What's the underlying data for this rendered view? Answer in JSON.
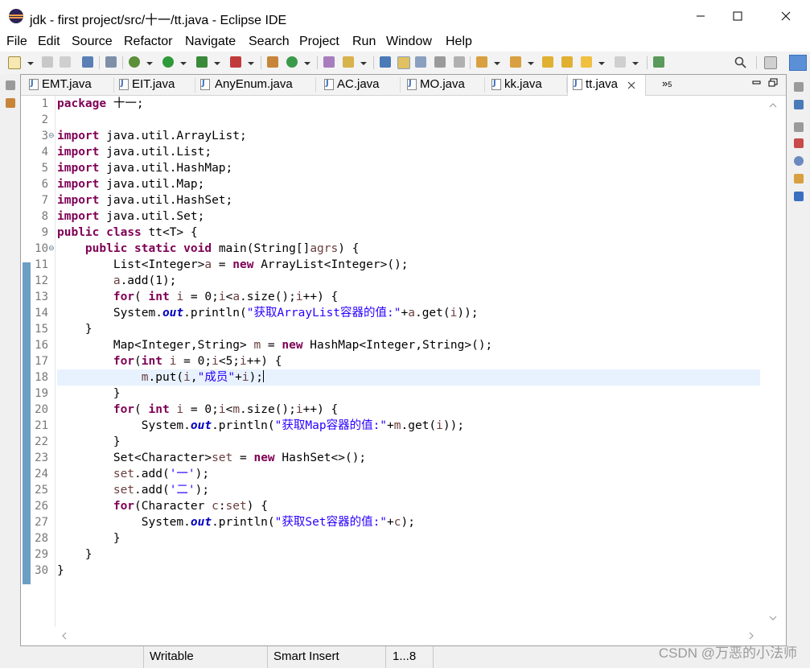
{
  "window": {
    "title": "jdk - first project/src/十一/tt.java - Eclipse IDE"
  },
  "menu": [
    "File",
    "Edit",
    "Source",
    "Refactor",
    "Navigate",
    "Search",
    "Project",
    "Run",
    "Window",
    "Help"
  ],
  "tabs": [
    "EMT.java",
    "EIT.java",
    "AnyEnum.java",
    "AC.java",
    "MO.java",
    "kk.java",
    "tt.java"
  ],
  "active_tab": "tt.java",
  "tabs_overflow_count": "5",
  "editor": {
    "line_numbers": [
      "1",
      "2",
      "3",
      "4",
      "5",
      "6",
      "7",
      "8",
      "9",
      "10",
      "11",
      "12",
      "13",
      "14",
      "15",
      "16",
      "17",
      "18",
      "19",
      "20",
      "21",
      "22",
      "23",
      "24",
      "25",
      "26",
      "27",
      "28",
      "29",
      "30"
    ],
    "lines": {
      "l1": {
        "a": "package",
        "b": " 十一;"
      },
      "l3": {
        "a": "import",
        "b": " java.util.ArrayList;"
      },
      "l4": {
        "a": "import",
        "b": " java.util.List;"
      },
      "l5": {
        "a": "import",
        "b": " java.util.HashMap;"
      },
      "l6": {
        "a": "import",
        "b": " java.util.Map;"
      },
      "l7": {
        "a": "import",
        "b": " java.util.HashSet;"
      },
      "l8": {
        "a": "import",
        "b": " java.util.Set;"
      },
      "l9": {
        "a": "public",
        "b": " ",
        "c": "class",
        "d": " tt<T> {"
      },
      "l10": {
        "pre": "    ",
        "a": "public",
        "b": " ",
        "c": "static",
        "d": " ",
        "e": "void",
        "f": " main(String[]",
        "g": "agrs",
        "h": ") {"
      },
      "l11": {
        "pre": "        List<Integer>",
        "a": "a",
        "b": " = ",
        "c": "new",
        "d": " ArrayList<Integer>();"
      },
      "l12": {
        "pre": "        ",
        "a": "a",
        "b": ".add(1);"
      },
      "l13": {
        "pre": "        ",
        "a": "for",
        "b": "( ",
        "c": "int",
        "d": " ",
        "e": "i",
        "f": " = 0;",
        "g": "i",
        "h": "<",
        "i": "a",
        "j": ".size();",
        "k": "i",
        "l": "++) {"
      },
      "l14": {
        "pre": "        System.",
        "a": "out",
        "b": ".println(",
        "c": "\"获取ArrayList容器的值:\"",
        "d": "+",
        "e": "a",
        "f": ".get(",
        "g": "i",
        "h": "));"
      },
      "l15": {
        "pre": "    }"
      },
      "l16": {
        "pre": "        Map<Integer,String> ",
        "a": "m",
        "b": " = ",
        "c": "new",
        "d": " HashMap<Integer,String>();"
      },
      "l17": {
        "pre": "        ",
        "a": "for",
        "b": "(",
        "c": "int",
        "d": " ",
        "e": "i",
        "f": " = 0;",
        "g": "i",
        "h": "<5;",
        "i": "i",
        "j": "++) {"
      },
      "l18": {
        "pre": "            ",
        "a": "m",
        "b": ".put(",
        "c": "i",
        "d": ",",
        "e": "\"成员\"",
        "f": "+",
        "g": "i",
        "h": ");"
      },
      "l19": {
        "pre": "        }"
      },
      "l20": {
        "pre": "        ",
        "a": "for",
        "b": "( ",
        "c": "int",
        "d": " ",
        "e": "i",
        "f": " = 0;",
        "g": "i",
        "h": "<",
        "i": "m",
        "j": ".size();",
        "k": "i",
        "l": "++) {"
      },
      "l21": {
        "pre": "            System.",
        "a": "out",
        "b": ".println(",
        "c": "\"获取Map容器的值:\"",
        "d": "+",
        "e": "m",
        "f": ".get(",
        "g": "i",
        "h": "));"
      },
      "l22": {
        "pre": "        }"
      },
      "l23": {
        "pre": "        Set<Character>",
        "a": "set",
        "b": " = ",
        "c": "new",
        "d": " HashSet<>();"
      },
      "l24": {
        "pre": "        ",
        "a": "set",
        "b": ".add(",
        "c": "'一'",
        "d": ");"
      },
      "l25": {
        "pre": "        ",
        "a": "set",
        "b": ".add(",
        "c": "'二'",
        "d": ");"
      },
      "l26": {
        "pre": "        ",
        "a": "for",
        "b": "(Character ",
        "c": "c",
        "d": ":",
        "e": "set",
        "f": ") {"
      },
      "l27": {
        "pre": "            System.",
        "a": "out",
        "b": ".println(",
        "c": "\"获取Set容器的值:\"",
        "d": "+",
        "e": "c",
        "f": ");"
      },
      "l28": {
        "pre": "        }"
      },
      "l29": {
        "pre": "    }"
      },
      "l30": {
        "pre": "}"
      }
    }
  },
  "status": {
    "mode": "Writable",
    "insert": "Smart Insert",
    "position": "1...8"
  },
  "watermark": "CSDN @万恶的小法师",
  "colors": {
    "keyword": "#7f0055",
    "string": "#2a00ff",
    "static_field": "#0000c0",
    "local_var": "#6a3e3e",
    "line_number": "#787878",
    "current_line": "#e8f2fe"
  }
}
